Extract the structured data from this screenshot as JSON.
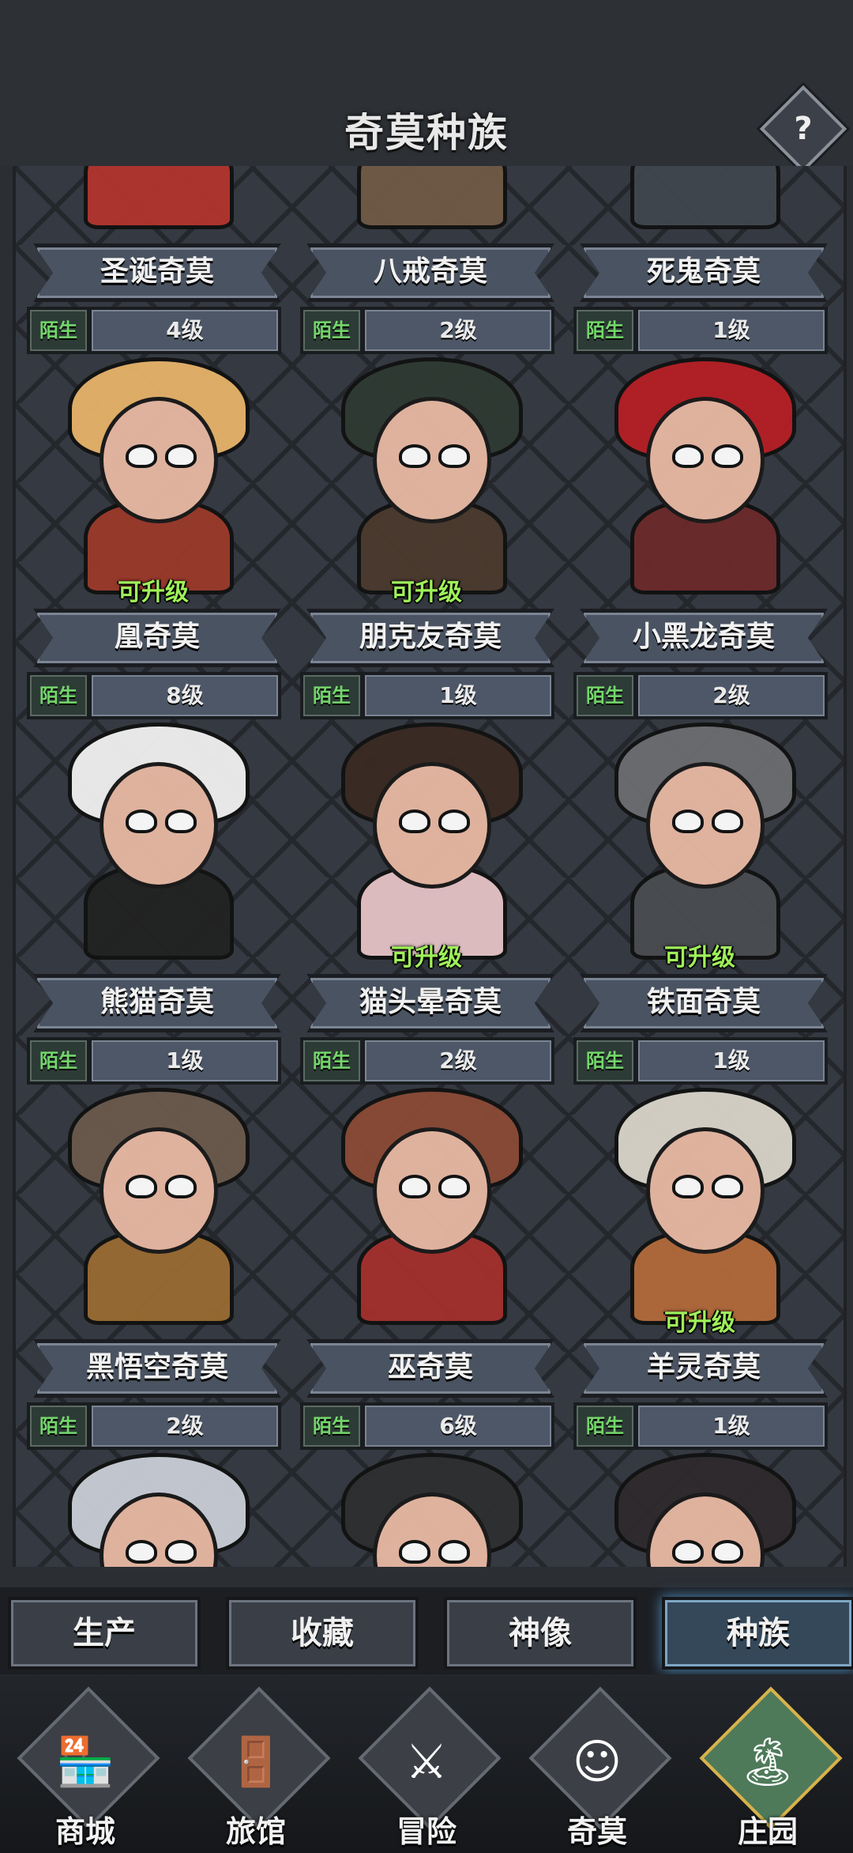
{
  "header": {
    "title": "奇莫种族",
    "help_label": "?"
  },
  "cards": [
    {
      "name": "圣诞奇莫",
      "status": "陌生",
      "level": "4级",
      "upgrade": "",
      "colors": {
        "hair": "#c53b34",
        "body": "#b3342e"
      }
    },
    {
      "name": "八戒奇莫",
      "status": "陌生",
      "level": "2级",
      "upgrade": "",
      "colors": {
        "hair": "#9b7b5a",
        "body": "#6f5a46"
      }
    },
    {
      "name": "死鬼奇莫",
      "status": "陌生",
      "level": "1级",
      "upgrade": "",
      "colors": {
        "hair": "#55606a",
        "body": "#3f464e"
      }
    },
    {
      "name": "凰奇莫",
      "status": "陌生",
      "level": "8级",
      "upgrade": "可升级",
      "colors": {
        "hair": "#e6b36a",
        "body": "#9b3a2a"
      }
    },
    {
      "name": "朋克友奇莫",
      "status": "陌生",
      "level": "1级",
      "upgrade": "可升级",
      "colors": {
        "hair": "#2f3a33",
        "body": "#4b3a2e"
      }
    },
    {
      "name": "小黑龙奇莫",
      "status": "陌生",
      "level": "2级",
      "upgrade": "",
      "colors": {
        "hair": "#b51f24",
        "body": "#6c2a2a"
      }
    },
    {
      "name": "熊猫奇莫",
      "status": "陌生",
      "level": "1级",
      "upgrade": "",
      "colors": {
        "hair": "#f1f1f1",
        "body": "#222"
      }
    },
    {
      "name": "猫头晕奇莫",
      "status": "陌生",
      "level": "2级",
      "upgrade": "可升级",
      "colors": {
        "hair": "#3a2a22",
        "body": "#e5c3c6"
      }
    },
    {
      "name": "铁面奇莫",
      "status": "陌生",
      "level": "1级",
      "upgrade": "可升级",
      "colors": {
        "hair": "#6b6d70",
        "body": "#4a4c50"
      }
    },
    {
      "name": "黑悟空奇莫",
      "status": "陌生",
      "level": "2级",
      "upgrade": "",
      "colors": {
        "hair": "#6a5a4c",
        "body": "#9a6b32"
      }
    },
    {
      "name": "巫奇莫",
      "status": "陌生",
      "level": "6级",
      "upgrade": "",
      "colors": {
        "hair": "#8a4a36",
        "body": "#a3302c"
      }
    },
    {
      "name": "羊灵奇莫",
      "status": "陌生",
      "level": "1级",
      "upgrade": "可升级",
      "colors": {
        "hair": "#d9d4c8",
        "body": "#b26a3a"
      }
    },
    {
      "name": "",
      "status": "",
      "level": "",
      "upgrade": "",
      "colors": {
        "hair": "#c9ced6",
        "body": "#d18a2c"
      }
    },
    {
      "name": "",
      "status": "",
      "level": "",
      "upgrade": "",
      "colors": {
        "hair": "#2e2f31",
        "body": "#3e3f42"
      }
    },
    {
      "name": "",
      "status": "",
      "level": "",
      "upgrade": "",
      "colors": {
        "hair": "#2f2a2c",
        "body": "#e4dcdc"
      }
    }
  ],
  "sub_tabs": [
    {
      "label": "生产",
      "active": false
    },
    {
      "label": "收藏",
      "active": false
    },
    {
      "label": "神像",
      "active": false
    },
    {
      "label": "种族",
      "active": true
    }
  ],
  "nav": [
    {
      "label": "商城",
      "icon": "shop-icon",
      "glyph": "🏪"
    },
    {
      "label": "旅馆",
      "icon": "inn-gate-icon",
      "glyph": "🚪"
    },
    {
      "label": "冒险",
      "icon": "crossed-swords-icon",
      "glyph": "⚔"
    },
    {
      "label": "奇莫",
      "icon": "qimo-character-icon",
      "glyph": "☺"
    },
    {
      "label": "庄园",
      "icon": "manor-island-icon",
      "glyph": "🏝"
    }
  ],
  "colors": {
    "upgrade_text": "#9ff05a",
    "status_text": "#74d66b",
    "active_tab_glow": "#4f8fc0"
  }
}
